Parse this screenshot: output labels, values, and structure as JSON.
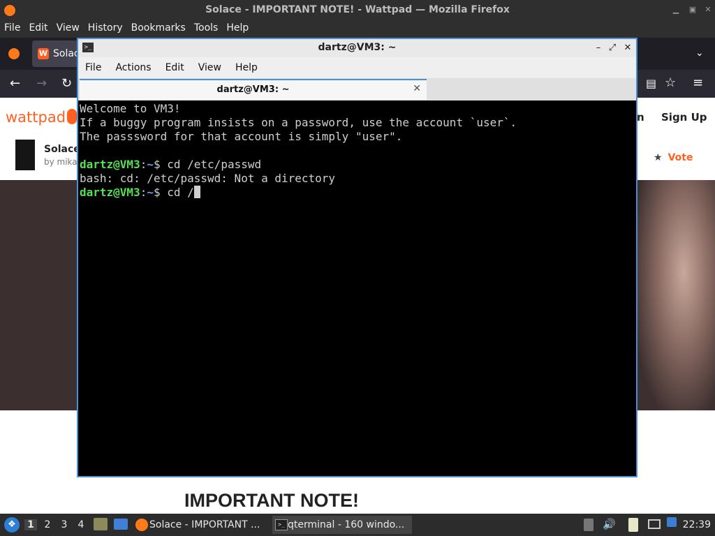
{
  "firefox": {
    "window_title": "Solace - IMPORTANT NOTE! - Wattpad — Mozilla Firefox",
    "menu": [
      "File",
      "Edit",
      "View",
      "History",
      "Bookmarks",
      "Tools",
      "Help"
    ],
    "tab_label": "Solac",
    "page": {
      "logo_text": "wattpad",
      "login_partial": "n",
      "signup": "Sign Up",
      "story_title": "Solace",
      "story_author": "by mikaf",
      "vote": "Vote",
      "heading": "IMPORTANT NOTE!"
    }
  },
  "terminal": {
    "window_title": "dartz@VM3: ~",
    "menu": [
      "File",
      "Actions",
      "Edit",
      "View",
      "Help"
    ],
    "tab_label": "dartz@VM3: ~",
    "lines": [
      "Welcome to VM3!",
      "If a buggy program insists on a password, use the account `user`.",
      "The passsword for that account is simply \"user\".",
      ""
    ],
    "prompt_user": "dartz@VM3",
    "prompt_sep": ":",
    "prompt_path": "~",
    "prompt_dollar": "$ ",
    "cmd1": "cd /etc/passwd",
    "error": "bash: cd: /etc/passwd: Not a directory",
    "cmd2": "cd /"
  },
  "taskbar": {
    "workspaces": [
      "1",
      "2",
      "3",
      "4"
    ],
    "tasks": [
      {
        "label": "Solace - IMPORTANT ..."
      },
      {
        "label": "qterminal - 160 windo..."
      }
    ],
    "clock": "22:39"
  }
}
